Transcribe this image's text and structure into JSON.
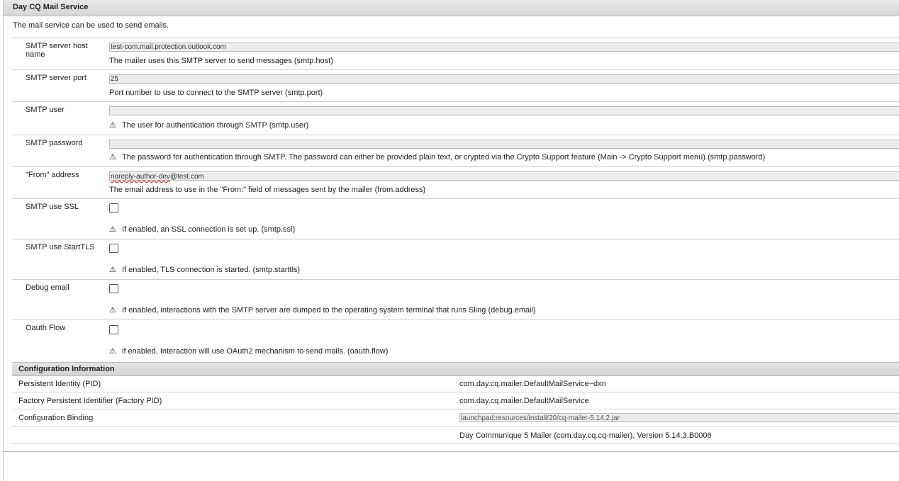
{
  "header": {
    "title": "Day CQ Mail Service"
  },
  "description": "The mail service can be used to send emails.",
  "fields": [
    {
      "label": "SMTP server host name",
      "value": "test-com.mail.protection.outlook.com",
      "hint": "The mailer uses this SMTP server to send messages (smtp.host)",
      "warn": false
    },
    {
      "label": "SMTP server port",
      "value": "25",
      "hint": "Port number to use to connect to the SMTP server (smtp.port)",
      "warn": false
    },
    {
      "label": "SMTP user",
      "value": "",
      "hint": "The user for authentication through SMTP (smtp.user)",
      "warn": true
    },
    {
      "label": "SMTP password",
      "value": "",
      "hint": "The password for authentication through SMTP. The password can either be provided plain text, or crypted via the Crypto Support feature (Main -> Crypto Support menu) (smtp.password)",
      "warn": true
    },
    {
      "label": "\"From\" address",
      "value_part1": "noreply-author-dev",
      "value_part2": "@test.com",
      "hint": "The email address to use in the \"From:\" field of messages sent by the mailer (from.address)",
      "warn": false
    }
  ],
  "checkboxes": [
    {
      "label": "SMTP use SSL",
      "checked": false,
      "hint": "If enabled, an SSL connection is set up. (smtp.ssl)"
    },
    {
      "label": "SMTP use StartTLS",
      "checked": false,
      "hint": "If enabled, TLS connection is started. (smtp.starttls)"
    },
    {
      "label": "Debug email",
      "checked": false,
      "hint": "If enabled, interactions with the SMTP server are dumped to the operating system terminal that runs Sling   (debug.email)"
    },
    {
      "label": "Oauth Flow",
      "checked": false,
      "hint": "if enabled, Interaction will use OAuth2 mechanism to send mails. (oauth.flow)"
    }
  ],
  "config": {
    "title": "Configuration Information",
    "rows": [
      {
        "key": "Persistent Identity (PID)",
        "value": "com.day.cq.mailer.DefaultMailService~dxn"
      },
      {
        "key": "Factory Persistent Identifier (Factory PID)",
        "value": "com.day.cq.mailer.DefaultMailService"
      },
      {
        "key": "Configuration Binding",
        "value": "launchpad:resources/install/20/cq-mailer-5.14.2.jar"
      },
      {
        "key": "",
        "value": "Day Communique 5 Mailer (com.day.cq.cq-mailer), Version 5.14.3.B0006"
      }
    ]
  },
  "icons": {
    "warning": "warning-icon"
  }
}
